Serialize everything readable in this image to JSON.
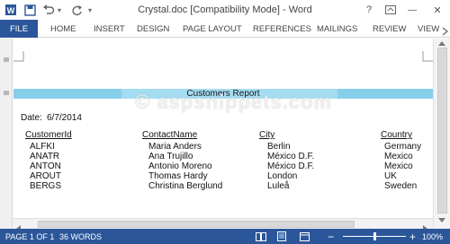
{
  "window": {
    "title": "Crystal.doc [Compatibility Mode] - Word",
    "controls": {
      "help": "?",
      "minimize": "—",
      "close": "✕"
    }
  },
  "qat": {
    "undo_dropdown": "▾",
    "customize": "▾"
  },
  "ribbon": {
    "tabs": [
      "FILE",
      "HOME",
      "INSERT",
      "DESIGN",
      "PAGE LAYOUT",
      "REFERENCES",
      "MAILINGS",
      "REVIEW",
      "VIEW"
    ]
  },
  "document": {
    "report_title": "Customers Report",
    "date_label": "Date:",
    "date_value": "6/7/2014",
    "columns": [
      "CustomerId",
      "ContactName",
      "City",
      "Country"
    ],
    "rows": [
      [
        "ALFKI",
        "Maria Anders",
        "Berlin",
        "Germany"
      ],
      [
        "ANATR",
        "Ana Trujillo",
        "México D.F.",
        "Mexico"
      ],
      [
        "ANTON",
        "Antonio Moreno",
        "México D.F.",
        "Mexico"
      ],
      [
        "AROUT",
        "Thomas Hardy",
        "London",
        "UK"
      ],
      [
        "BERGS",
        "Christina Berglund",
        "Luleå",
        "Sweden"
      ]
    ],
    "watermark": "© aspsnippets.com"
  },
  "status": {
    "page": "PAGE 1 OF 1",
    "words": "36 WORDS",
    "zoom_minus": "−",
    "zoom_plus": "+",
    "zoom": "100%",
    "zoom_level_fraction": 0.5
  },
  "colors": {
    "accent": "#2b579a",
    "report_band": "#87ceeb"
  }
}
